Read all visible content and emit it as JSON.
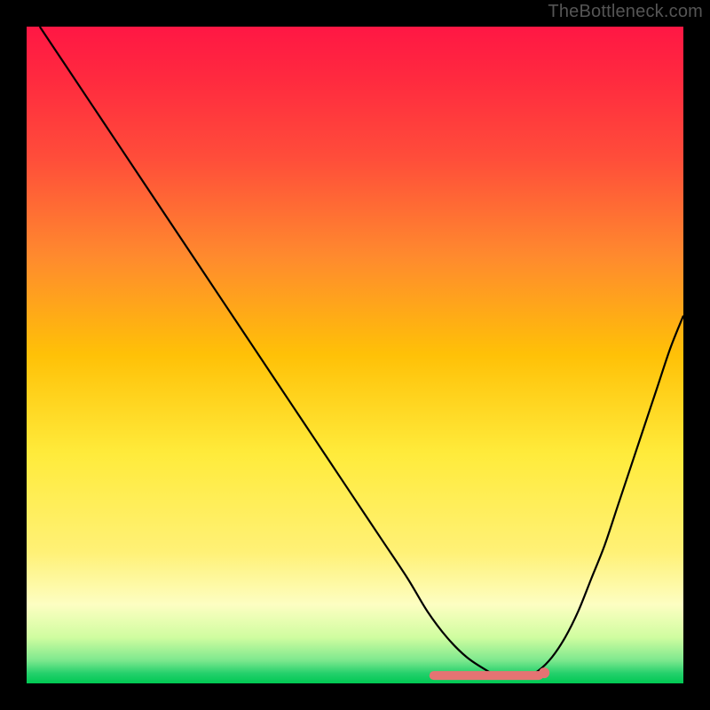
{
  "watermark": "TheBottleneck.com",
  "chart_data": {
    "type": "line",
    "title": "",
    "xlabel": "",
    "ylabel": "",
    "xlim": [
      0,
      100
    ],
    "ylim": [
      0,
      100
    ],
    "background_gradient": {
      "stops": [
        {
          "pos": 0.0,
          "color": "#ff1744"
        },
        {
          "pos": 0.08,
          "color": "#ff2a3f"
        },
        {
          "pos": 0.2,
          "color": "#ff4d3a"
        },
        {
          "pos": 0.35,
          "color": "#ff8a2e"
        },
        {
          "pos": 0.5,
          "color": "#ffc107"
        },
        {
          "pos": 0.65,
          "color": "#ffeb3b"
        },
        {
          "pos": 0.8,
          "color": "#fff176"
        },
        {
          "pos": 0.88,
          "color": "#fdfec2"
        },
        {
          "pos": 0.93,
          "color": "#d0fda0"
        },
        {
          "pos": 0.965,
          "color": "#7de88e"
        },
        {
          "pos": 0.985,
          "color": "#24d06b"
        },
        {
          "pos": 1.0,
          "color": "#00c853"
        }
      ]
    },
    "series": [
      {
        "name": "bottleneck-curve",
        "color": "#000000",
        "x": [
          2,
          6,
          10,
          14,
          18,
          22,
          26,
          30,
          34,
          38,
          42,
          46,
          50,
          54,
          58,
          61,
          64,
          67,
          70,
          72,
          74,
          76,
          78,
          80,
          82,
          84,
          86,
          88,
          90,
          92,
          94,
          96,
          98,
          100
        ],
        "y": [
          100,
          94,
          88,
          82,
          76,
          70,
          64,
          58,
          52,
          46,
          40,
          34,
          28,
          22,
          16,
          11,
          7,
          4,
          2,
          1,
          1,
          1,
          2,
          4,
          7,
          11,
          16,
          21,
          27,
          33,
          39,
          45,
          51,
          56
        ]
      }
    ],
    "flat_band": {
      "color": "#e57373",
      "y": 1.2,
      "x_start": 62,
      "x_end": 78,
      "thickness_px": 10,
      "end_dot_radius_px": 6
    }
  }
}
